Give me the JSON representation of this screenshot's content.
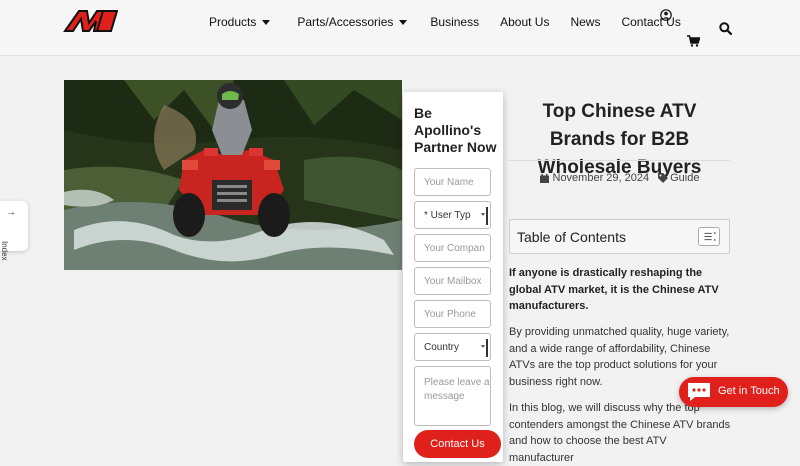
{
  "header": {
    "logo_text": "AM",
    "nav": {
      "products": "Products",
      "parts": "Parts/Accessories",
      "business": "Business",
      "about": "About Us",
      "news": "News",
      "contact": "Contact Us"
    },
    "icons": [
      "user-icon",
      "cart-icon",
      "search-icon"
    ]
  },
  "side_index": {
    "label": "Index",
    "arrow": "→"
  },
  "form": {
    "title": "Be Apollino's Partner Now",
    "fields": {
      "name_placeholder": "Your Name",
      "user_type_value": "* User Typ",
      "company_placeholder": "Your Compan",
      "mailbox_placeholder": "Your Mailbox",
      "phone_placeholder": "Your Phone",
      "country_value": "Country",
      "message_placeholder": "Please leave a message"
    },
    "submit_label": "Contact Us"
  },
  "article": {
    "title": "Top Chinese ATV Brands for B2B Wholesale Buyers",
    "date": "November 29, 2024",
    "category": "Guide",
    "toc_title": "Table of Contents",
    "intro_bold": "If anyone is drastically reshaping the global ATV market, it is the Chinese ATV manufacturers.",
    "para1": "By providing unmatched quality, huge variety, and a wide range of affordability, Chinese ATVs are the top product solutions for your business right now.",
    "para2": "In this blog, we will discuss why the top contenders amongst the Chinese ATV brands and how to choose the best ATV manufacturer"
  },
  "chat": {
    "label": "Get in Touch"
  },
  "colors": {
    "accent": "#e0201b",
    "background": "#f2f2f2"
  }
}
